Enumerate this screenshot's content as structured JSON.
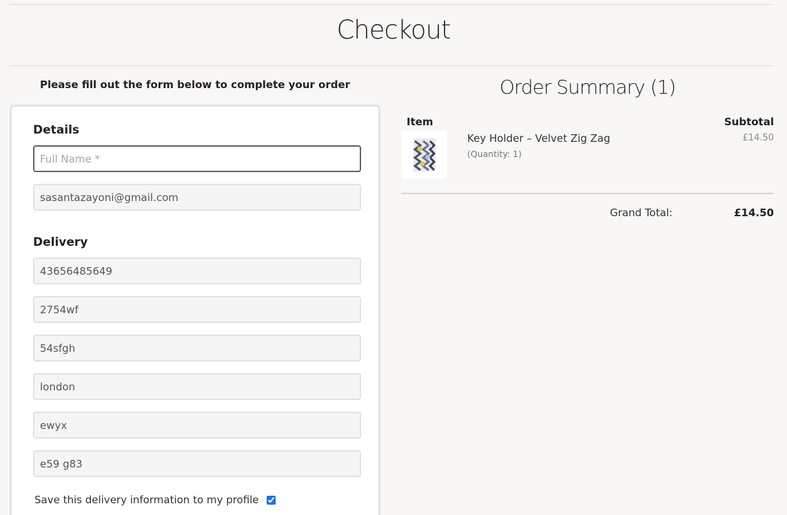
{
  "page": {
    "title": "Checkout",
    "instructions": "Please fill out the form below to complete your order"
  },
  "form": {
    "details_label": "Details",
    "full_name": {
      "placeholder": "Full Name *",
      "value": ""
    },
    "email": {
      "value": "sasantazayoni@gmail.com"
    },
    "delivery_label": "Delivery",
    "phone": {
      "value": "43656485649"
    },
    "postcode": {
      "value": "2754wf"
    },
    "street_address1": {
      "value": "54sfgh"
    },
    "town_or_city": {
      "value": "london"
    },
    "street_address2": {
      "value": "ewyx"
    },
    "county": {
      "value": "e59 g83"
    },
    "save_info_label": "Save this delivery information to my profile",
    "save_info_checked": true
  },
  "summary": {
    "title": "Order Summary (1)",
    "item_header": "Item",
    "subtotal_header": "Subtotal",
    "items": [
      {
        "name": "Key Holder – Velvet Zig Zag",
        "quantity": "(Quantity: 1)",
        "price": "£14.50",
        "image_icon": "key-holder-zigzag-thumbnail"
      }
    ],
    "grand_total_label": "Grand Total:",
    "grand_total_value": "£14.50"
  }
}
